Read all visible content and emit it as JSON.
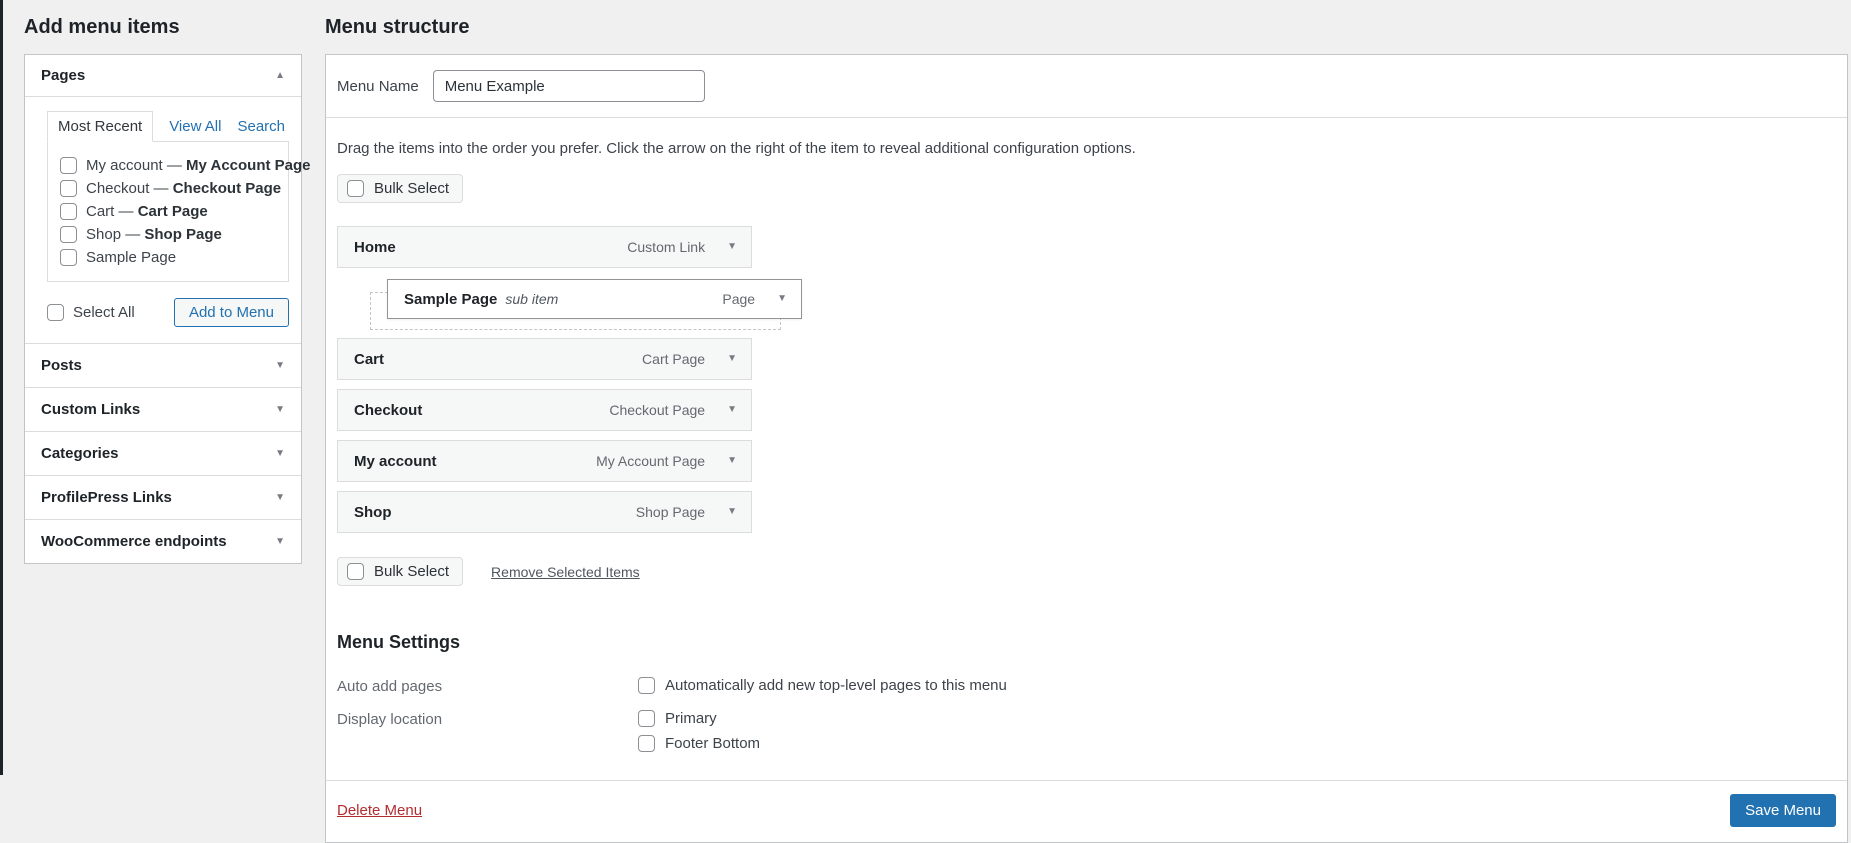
{
  "colors": {
    "accent": "#2271b1",
    "page_bg": "#f0f0f1",
    "card_bg": "#ffffff",
    "item_bar_bg": "#f6f7f7",
    "delete_red": "#b32d2e"
  },
  "sidebar": {
    "title": "Add menu items",
    "pages_panel": {
      "title": "Pages",
      "tabs": [
        {
          "label": "Most Recent",
          "active": true
        },
        {
          "label": "View All",
          "active": false
        },
        {
          "label": "Search",
          "active": false
        }
      ],
      "items": [
        {
          "prefix": "My account — ",
          "bold": "My Account Page"
        },
        {
          "prefix": "Checkout — ",
          "bold": "Checkout Page"
        },
        {
          "prefix": "Cart — ",
          "bold": "Cart Page"
        },
        {
          "prefix": "Shop — ",
          "bold": "Shop Page"
        },
        {
          "prefix": "Sample Page",
          "bold": ""
        }
      ],
      "select_all_label": "Select All",
      "add_to_menu_label": "Add to Menu"
    },
    "sections": [
      "Posts",
      "Custom Links",
      "Categories",
      "ProfilePress Links",
      "WooCommerce endpoints"
    ]
  },
  "main": {
    "title": "Menu structure",
    "menu_name_label": "Menu Name",
    "menu_name_value": "Menu Example",
    "instructions": "Drag the items into the order you prefer. Click the arrow on the right of the item to reveal additional configuration options.",
    "bulk_select_label": "Bulk Select",
    "remove_selected_label": "Remove Selected Items",
    "menu_items": [
      {
        "title": "Home",
        "type": "Custom Link"
      },
      {
        "title": "Sample Page",
        "badge": "sub item",
        "type": "Page"
      },
      {
        "title": "Cart",
        "type": "Cart Page"
      },
      {
        "title": "Checkout",
        "type": "Checkout Page"
      },
      {
        "title": "My account",
        "type": "My Account Page"
      },
      {
        "title": "Shop",
        "type": "Shop Page"
      }
    ],
    "settings": {
      "title": "Menu Settings",
      "auto_add_label": "Auto add pages",
      "auto_add_option": "Automatically add new top-level pages to this menu",
      "display_location_label": "Display location",
      "locations": [
        "Primary",
        "Footer Bottom"
      ]
    },
    "footer": {
      "delete_label": "Delete Menu",
      "save_label": "Save Menu"
    }
  }
}
